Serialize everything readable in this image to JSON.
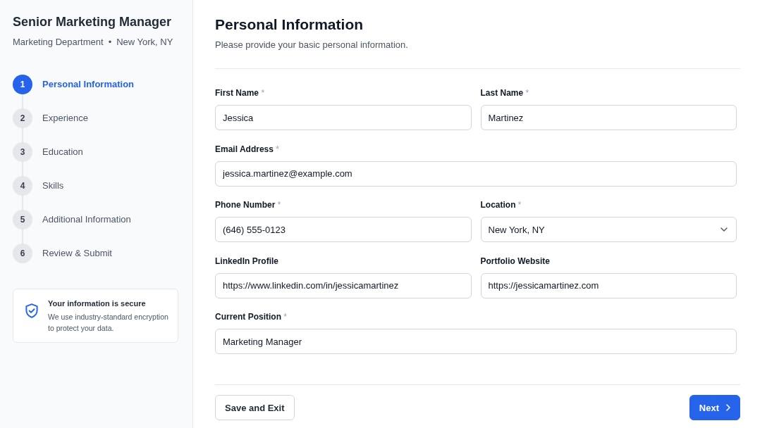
{
  "sidebar": {
    "title": "Senior Marketing Manager",
    "department": "Marketing Department",
    "separator": "•",
    "location": "New York, NY",
    "steps": [
      {
        "number": "1",
        "label": "Personal Information",
        "selected": true
      },
      {
        "number": "2",
        "label": "Experience",
        "selected": false
      },
      {
        "number": "3",
        "label": "Education",
        "selected": false
      },
      {
        "number": "4",
        "label": "Skills",
        "selected": false
      },
      {
        "number": "5",
        "label": "Additional Information",
        "selected": false
      },
      {
        "number": "6",
        "label": "Review & Submit",
        "selected": false
      }
    ],
    "notice": {
      "title": "Your information is secure",
      "text": "We use industry-standard encryption to protect your data."
    }
  },
  "form": {
    "title": "Personal Information",
    "subtitle": "Please provide your basic personal information.",
    "rows": [
      {
        "fields": [
          {
            "label": "First Name",
            "required_mark": "*",
            "kind": "text",
            "value": "Jessica"
          },
          {
            "label": "Last Name",
            "required_mark": "*",
            "kind": "text",
            "value": "Martinez"
          }
        ]
      },
      {
        "fields": [
          {
            "label": "Email Address",
            "required_mark": "*",
            "kind": "text",
            "value": "jessica.martinez@example.com"
          }
        ]
      },
      {
        "fields": [
          {
            "label": "Phone Number",
            "required_mark": "*",
            "kind": "text",
            "value": "(646) 555-0123"
          },
          {
            "label": "Location",
            "required_mark": "*",
            "kind": "select",
            "value": "New York, NY"
          }
        ]
      },
      {
        "fields": [
          {
            "label": "LinkedIn Profile",
            "kind": "text",
            "value": "https://www.linkedin.com/in/jessicamartinez"
          },
          {
            "label": "Portfolio Website",
            "kind": "text",
            "value": "https://jessicamartinez.com"
          }
        ]
      },
      {
        "fields": [
          {
            "label": "Current Position",
            "required_mark": "*",
            "kind": "text",
            "value": "Marketing Manager"
          }
        ]
      }
    ],
    "actions": [
      {
        "label": "Save and Exit",
        "kind": "secondary"
      },
      {
        "label": "Next",
        "kind": "primary"
      }
    ]
  }
}
